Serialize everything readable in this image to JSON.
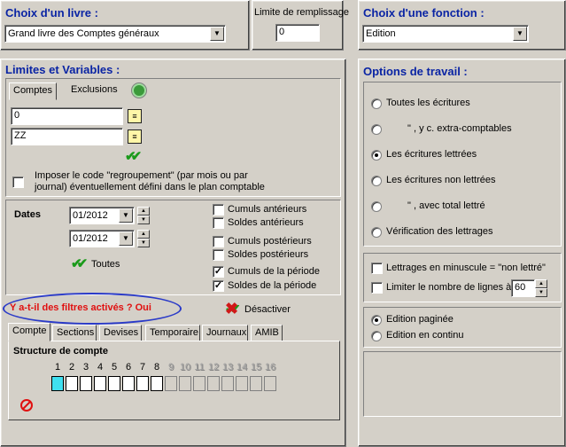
{
  "livre": {
    "title": "Choix d'un livre :",
    "selected": "Grand livre des Comptes généraux",
    "limite_label": "Limite de remplissage",
    "limite_value": "0"
  },
  "fonction": {
    "title": "Choix d'une fonction :",
    "selected": "Edition"
  },
  "limites": {
    "title": "Limites et Variables :",
    "tabs": [
      "Comptes",
      "Exclusions"
    ],
    "from_value": "0",
    "to_value": "ZZ",
    "regroupement_text": "Imposer le code \"regroupement\" (par mois ou par journal) éventuellement défini dans le plan comptable",
    "dates_label": "Dates",
    "date_from": "01/2012",
    "date_to": "01/2012",
    "toutes_label": "Toutes",
    "cumuls": [
      {
        "label": "Cumuls antérieurs",
        "checked": false
      },
      {
        "label": "Soldes antérieurs",
        "checked": false
      },
      {
        "label": "Cumuls postérieurs",
        "checked": false
      },
      {
        "label": "Soldes postérieurs",
        "checked": false
      },
      {
        "label": "Cumuls de la période",
        "checked": true
      },
      {
        "label": "Soldes de la période",
        "checked": true
      }
    ],
    "filtres_text": "Y a-t-il des filtres activés ? Oui",
    "desactiver_label": "Désactiver",
    "bottom_tabs": [
      "Compte",
      "Sections",
      "Devises",
      "Temporaire",
      "Journaux",
      "AMIB"
    ],
    "structure_label": "Structure de compte",
    "structure_numbers": [
      "1",
      "2",
      "3",
      "4",
      "5",
      "6",
      "7",
      "8",
      "9",
      "10",
      "11",
      "12",
      "13",
      "14",
      "15",
      "16"
    ],
    "structure_enabled_count": 8
  },
  "options": {
    "title": "Options de travail :",
    "radios": [
      {
        "label": "Toutes les écritures",
        "checked": false
      },
      {
        "label": "\"        , y c. extra-comptables",
        "checked": false
      },
      {
        "label": "Les écritures lettrées",
        "checked": true
      },
      {
        "label": "Les écritures non lettrées",
        "checked": false
      },
      {
        "label": "\"        , avec total lettré",
        "checked": false
      },
      {
        "label": "Vérification des lettrages",
        "checked": false
      }
    ],
    "minuscules_label": "Lettrages en minuscule = \"non lettré\"",
    "limiter_label": "Limiter le nombre de lignes à :",
    "limiter_value": "60",
    "edition_paginee": "Edition paginée",
    "edition_continu": "Edition en continu"
  }
}
